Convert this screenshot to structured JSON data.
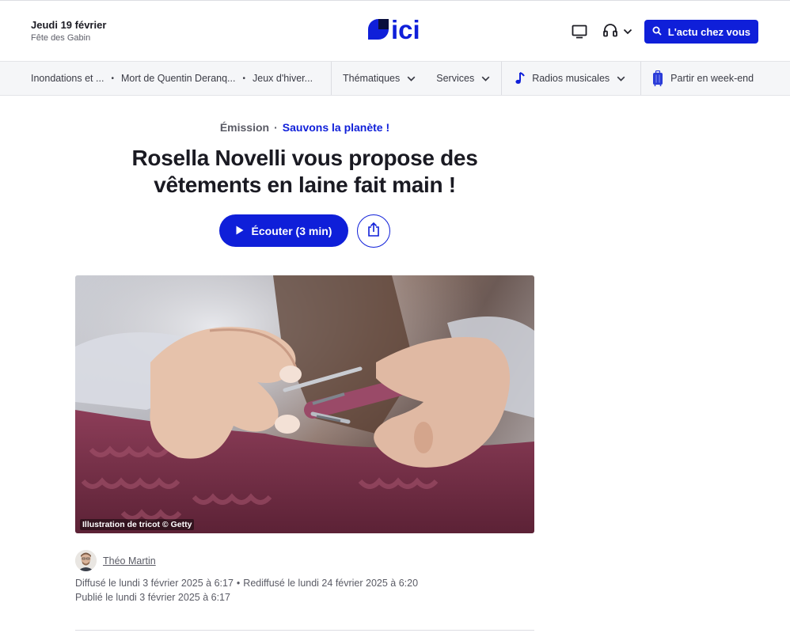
{
  "header": {
    "date": "Jeudi 19 février",
    "saint": "Fête des Gabin",
    "logo_text": "ici",
    "cta_label": "L'actu chez vous"
  },
  "nav": {
    "trending": [
      "Inondations et ...",
      "Mort de Quentin Deranq...",
      "Jeux d'hiver..."
    ],
    "thematiques": "Thématiques",
    "services": "Services",
    "radios": "Radios musicales",
    "weekend": "Partir en week-end"
  },
  "article": {
    "type": "Émission",
    "show": "Sauvons la planète !",
    "title": "Rosella Novelli vous propose des vêtements en laine fait main !",
    "listen_label": "Écouter (3 min)",
    "image_caption": "Illustration de tricot © Getty",
    "author": "Théo Martin",
    "broadcast": "Diffusé le lundi 3 février 2025 à 6:17",
    "rebroadcast": "Rediffusé le lundi 24 février 2025 à 6:20",
    "published": "Publié le lundi 3 février 2025 à 6:17"
  },
  "colors": {
    "brand_blue": "#0f1fd9",
    "text_dark": "#1c1c24",
    "text_muted": "#5a5b65"
  },
  "icons": {
    "tv": "tv-icon",
    "headphones": "headphones-icon",
    "search": "search-icon",
    "play": "play-icon",
    "share": "share-icon",
    "music": "music-note-icon",
    "luggage": "luggage-icon"
  }
}
